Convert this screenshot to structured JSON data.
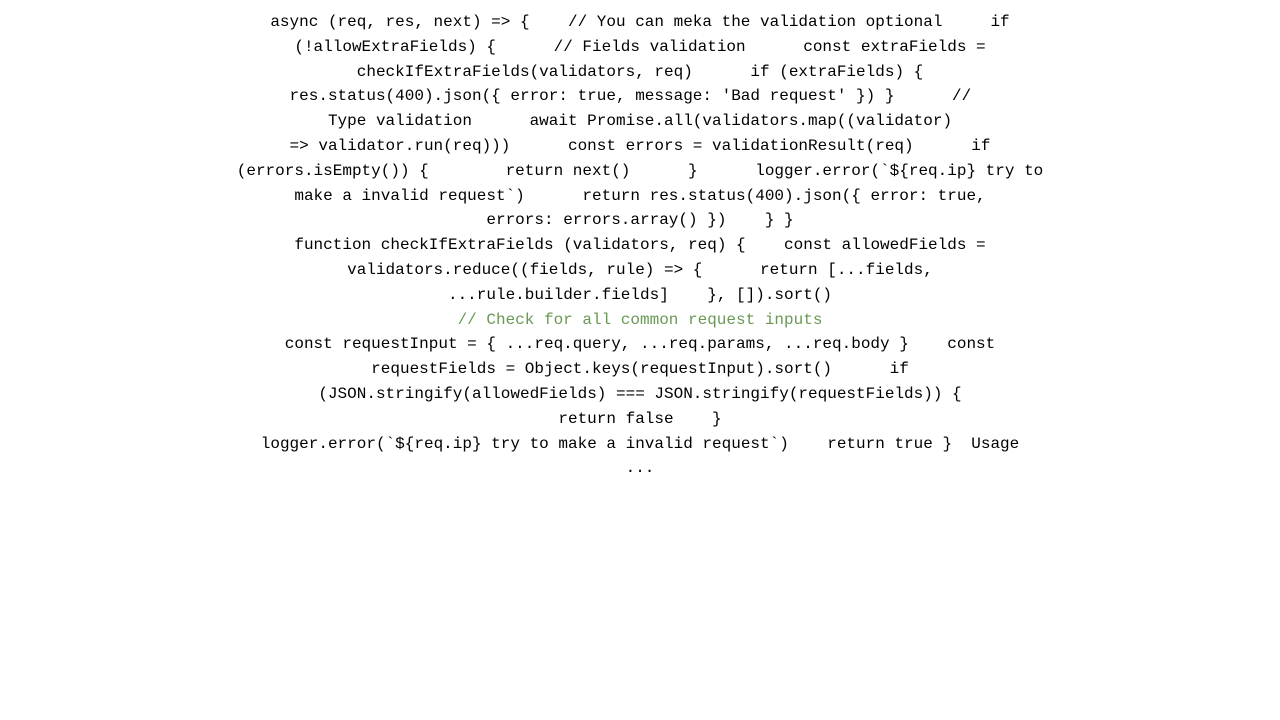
{
  "code": {
    "lines": [
      {
        "type": "code",
        "text": "async (req, res, next) => {    // You can meka the validation optional     if"
      },
      {
        "type": "code",
        "text": "(!allowExtraFields) {      // Fields validation      const extraFields ="
      },
      {
        "type": "code",
        "text": "checkIfExtraFields(validators, req)      if (extraFields) {"
      },
      {
        "type": "code",
        "text": "res.status(400).json({ error: true, message: 'Bad request' }) }      //  "
      },
      {
        "type": "code",
        "text": "Type validation      await Promise.all(validators.map((validator)"
      },
      {
        "type": "code",
        "text": "=> validator.run(req)))      const errors = validationResult(req)      if"
      },
      {
        "type": "code",
        "text": "(errors.isEmpty()) {        return next()      }      logger.error(`${req.ip} try to"
      },
      {
        "type": "code",
        "text": "make a invalid request`)      return res.status(400).json({ error: true,"
      },
      {
        "type": "code",
        "text": "errors: errors.array() })    } }"
      },
      {
        "type": "code",
        "text": "function checkIfExtraFields (validators, req) {    const allowedFields ="
      },
      {
        "type": "code",
        "text": "validators.reduce((fields, rule) => {      return [...fields,"
      },
      {
        "type": "code",
        "text": "...rule.builder.fields]    }, []).sort()"
      },
      {
        "type": "comment",
        "text": "// Check for all common request inputs"
      },
      {
        "type": "code",
        "text": "const requestInput = { ...req.query, ...req.params, ...req.body }    const"
      },
      {
        "type": "code",
        "text": "requestFields = Object.keys(requestInput).sort()      if"
      },
      {
        "type": "code",
        "text": "(JSON.stringify(allowedFields) === JSON.stringify(requestFields)) {"
      },
      {
        "type": "code",
        "text": "return false    }"
      },
      {
        "type": "code",
        "text": "logger.error(`${req.ip} try to make a invalid request`)    return true }  Usage"
      },
      {
        "type": "code",
        "text": "..."
      }
    ]
  }
}
